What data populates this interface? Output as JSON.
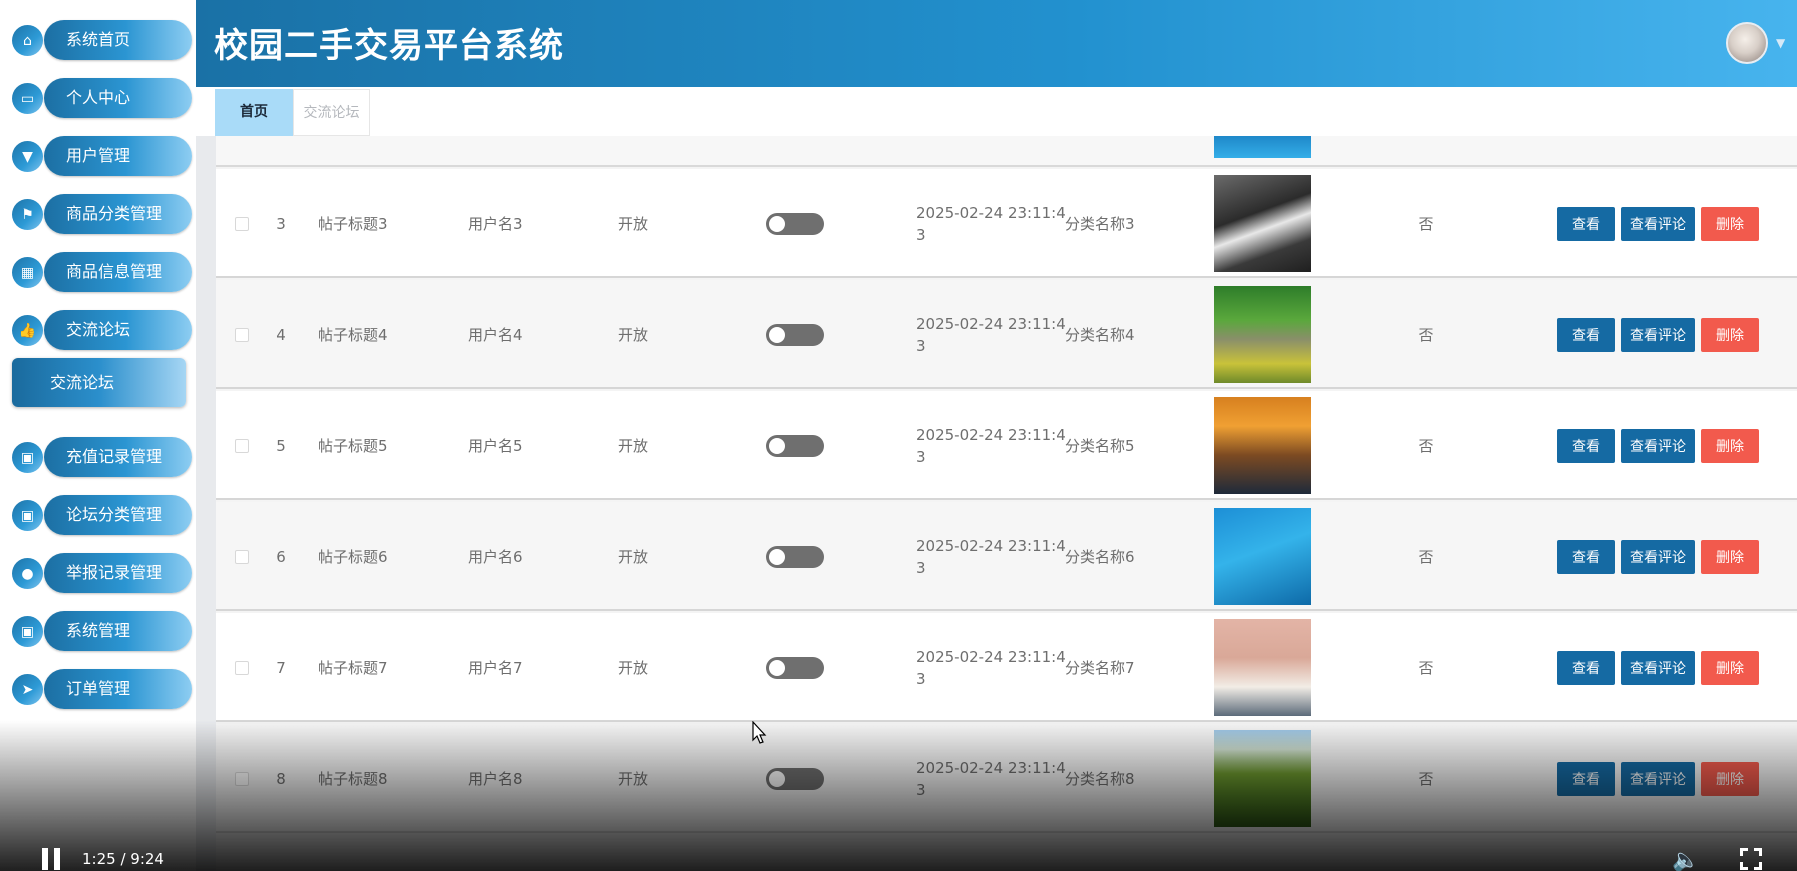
{
  "app": {
    "title": "校园二手交易平台系统"
  },
  "sidebar": {
    "items": [
      {
        "label": "系统首页",
        "icon": "home-icon",
        "glyph": "⌂"
      },
      {
        "label": "个人中心",
        "icon": "card-icon",
        "glyph": "▭"
      },
      {
        "label": "用户管理",
        "icon": "stamp-icon",
        "glyph": "▼"
      },
      {
        "label": "商品分类管理",
        "icon": "flag-icon",
        "glyph": "⚑"
      },
      {
        "label": "商品信息管理",
        "icon": "grid-icon",
        "glyph": "▦"
      },
      {
        "label": "交流论坛",
        "icon": "thumb-up-icon",
        "glyph": "👍"
      },
      {
        "label": "充值记录管理",
        "icon": "apps-icon",
        "glyph": "▣"
      },
      {
        "label": "论坛分类管理",
        "icon": "apps-icon",
        "glyph": "▣"
      },
      {
        "label": "举报记录管理",
        "icon": "user-icon",
        "glyph": "●"
      },
      {
        "label": "系统管理",
        "icon": "apps-icon",
        "glyph": "▣"
      },
      {
        "label": "订单管理",
        "icon": "send-icon",
        "glyph": "➤"
      }
    ],
    "submenu": {
      "label": "交流论坛"
    }
  },
  "tabs": [
    {
      "label": "首页",
      "active": true
    },
    {
      "label": "交流论坛",
      "active": false
    }
  ],
  "table": {
    "rows": [
      {
        "index": "3",
        "title": "帖子标题3",
        "user": "用户名3",
        "status": "开放",
        "time": "2025-02-24 23:11:43",
        "category": "分类名称3",
        "flag": "否",
        "image": "fitness-photo"
      },
      {
        "index": "4",
        "title": "帖子标题4",
        "user": "用户名4",
        "status": "开放",
        "time": "2025-02-24 23:11:43",
        "category": "分类名称4",
        "flag": "否",
        "image": "stone-bridge-photo"
      },
      {
        "index": "5",
        "title": "帖子标题5",
        "user": "用户名5",
        "status": "开放",
        "time": "2025-02-24 23:11:43",
        "category": "分类名称5",
        "flag": "否",
        "image": "sunset-photo"
      },
      {
        "index": "6",
        "title": "帖子标题6",
        "user": "用户名6",
        "status": "开放",
        "time": "2025-02-24 23:11:43",
        "category": "分类名称6",
        "flag": "否",
        "image": "swimmer-photo"
      },
      {
        "index": "7",
        "title": "帖子标题7",
        "user": "用户名7",
        "status": "开放",
        "time": "2025-02-24 23:11:43",
        "category": "分类名称7",
        "flag": "否",
        "image": "books-photo"
      },
      {
        "index": "8",
        "title": "帖子标题8",
        "user": "用户名8",
        "status": "开放",
        "time": "2025-02-24 23:11:43",
        "category": "分类名称8",
        "flag": "否",
        "image": "hills-photo"
      }
    ],
    "actions": {
      "view": "查看",
      "comments": "查看评论",
      "delete": "删除"
    }
  },
  "video": {
    "time": "1:25 / 9:24"
  },
  "colors": {
    "header_start": "#1a71a6",
    "header_end": "#47b4ee",
    "button_primary": "#156aa3",
    "button_danger": "#f25a4d",
    "tab_active": "#a9dbf8"
  }
}
